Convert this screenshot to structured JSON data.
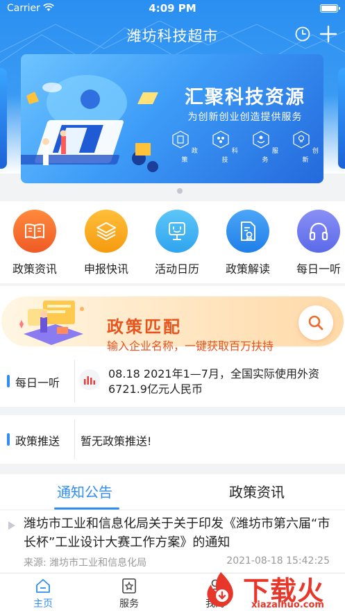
{
  "status_bar": {
    "carrier": "Carrier",
    "time": "4:09 PM"
  },
  "nav": {
    "title": "潍坊科技超市"
  },
  "banner": {
    "title": "汇聚科技资源",
    "subtitle": "为创新创业创造提供服务",
    "features": [
      "政策",
      "科技",
      "服务",
      "创新"
    ]
  },
  "quick_entries": [
    {
      "label": "政策资讯",
      "color": "#f26a2a"
    },
    {
      "label": "申报快讯",
      "color": "#f6a21c"
    },
    {
      "label": "活动日历",
      "color": "#3db0f2"
    },
    {
      "label": "政策解读",
      "color": "#2b8ff0"
    },
    {
      "label": "每日一听",
      "color": "#6a7cf0"
    }
  ],
  "policy_match": {
    "title": "政策匹配",
    "subtitle": "输入企业名称，一键获取百万扶持"
  },
  "daily_listen": {
    "label": "每日一听",
    "text": "08.18 2021年1—7月，全国实际使用外资6721.9亿元人民币"
  },
  "policy_push": {
    "label": "政策推送",
    "text": "暂无政策推送!"
  },
  "tabs": [
    {
      "label": "通知公告",
      "active": true
    },
    {
      "label": "政策资讯",
      "active": false
    }
  ],
  "news": [
    {
      "title": "潍坊市工业和信息化局关于关于印发《潍坊市第六届“市长杯”工业设计大赛工作方案》的通知",
      "source": "来源: 潍坊市工业和信息化局",
      "time": "2021-08-18 15:42:25"
    }
  ],
  "tabbar": [
    {
      "label": "主页",
      "icon": "home-icon",
      "active": true
    },
    {
      "label": "服务",
      "icon": "service-icon",
      "active": false
    },
    {
      "label": "我的",
      "icon": "user-icon",
      "active": false
    }
  ],
  "watermark": {
    "text": "下载火",
    "url": "xiazaihuo.com"
  },
  "colors": {
    "primary": "#2f8cf0",
    "accent_orange": "#e8541e",
    "watermark_red": "#e7362a"
  }
}
